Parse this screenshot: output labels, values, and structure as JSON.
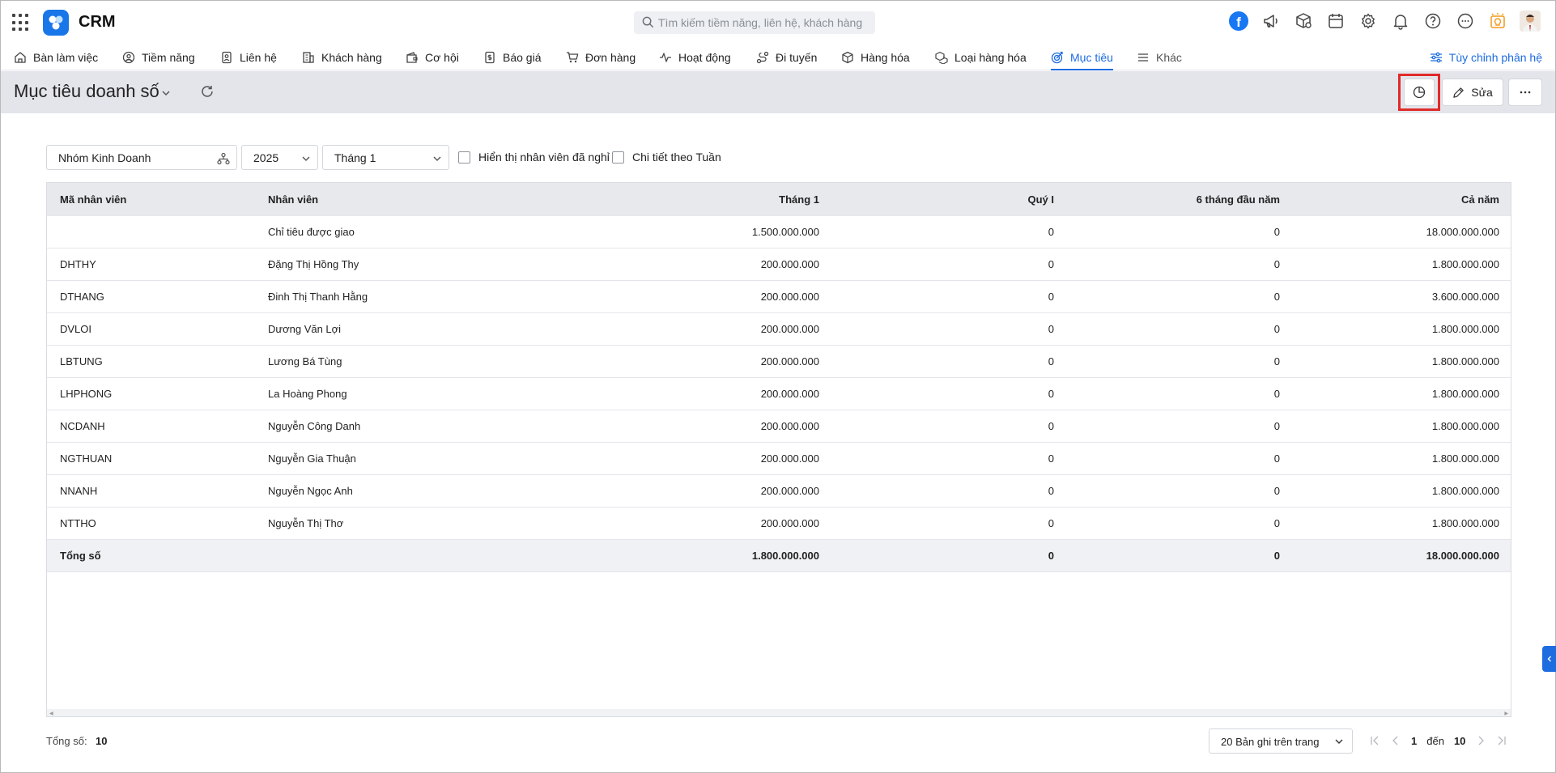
{
  "app": {
    "title": "CRM"
  },
  "search": {
    "placeholder": "Tìm kiếm tiềm năng, liên hệ, khách hàng"
  },
  "top_icons": [
    "facebook-icon",
    "megaphone-icon",
    "package-search-icon",
    "calendar-icon",
    "gear-icon",
    "bell-icon",
    "help-icon",
    "chat-icon",
    "lightbulb-icon",
    "avatar"
  ],
  "nav": {
    "items": [
      {
        "label": "Bàn làm việc",
        "icon": "home-icon"
      },
      {
        "label": "Tiềm năng",
        "icon": "person-circle-icon"
      },
      {
        "label": "Liên hệ",
        "icon": "contact-card-icon"
      },
      {
        "label": "Khách hàng",
        "icon": "building-icon"
      },
      {
        "label": "Cơ hội",
        "icon": "wallet-icon"
      },
      {
        "label": "Báo giá",
        "icon": "quote-icon"
      },
      {
        "label": "Đơn hàng",
        "icon": "cart-icon"
      },
      {
        "label": "Hoạt động",
        "icon": "pulse-icon"
      },
      {
        "label": "Đi tuyến",
        "icon": "route-icon"
      },
      {
        "label": "Hàng hóa",
        "icon": "box-icon"
      },
      {
        "label": "Loại hàng hóa",
        "icon": "boxes-icon"
      },
      {
        "label": "Mục tiêu",
        "icon": "target-icon",
        "active": true
      },
      {
        "label": "Khác",
        "icon": "menu-icon"
      }
    ],
    "customize_label": "Tùy chỉnh phân hệ"
  },
  "page": {
    "title": "Mục tiêu doanh số",
    "edit_label": "Sửa"
  },
  "filters": {
    "group": "Nhóm Kinh Doanh",
    "year": "2025",
    "month": "Tháng 1",
    "show_inactive_label": "Hiển thị nhân viên đã nghỉ",
    "weekly_detail_label": "Chi tiết theo Tuần"
  },
  "table": {
    "headers": {
      "code": "Mã nhân viên",
      "name": "Nhân viên",
      "month": "Tháng 1",
      "quarter": "Quý I",
      "half": "6 tháng đầu năm",
      "year": "Cả năm"
    },
    "rows": [
      {
        "code": "",
        "name": "Chỉ tiêu được giao",
        "month": "1.500.000.000",
        "quarter": "0",
        "half": "0",
        "year": "18.000.000.000"
      },
      {
        "code": "DHTHY",
        "name": "Đặng Thị Hồng Thy",
        "month": "200.000.000",
        "quarter": "0",
        "half": "0",
        "year": "1.800.000.000"
      },
      {
        "code": "DTHANG",
        "name": "Đinh Thị Thanh Hằng",
        "month": "200.000.000",
        "quarter": "0",
        "half": "0",
        "year": "3.600.000.000"
      },
      {
        "code": "DVLOI",
        "name": "Dương Văn Lợi",
        "month": "200.000.000",
        "quarter": "0",
        "half": "0",
        "year": "1.800.000.000"
      },
      {
        "code": "LBTUNG",
        "name": "Lương Bá Tùng",
        "month": "200.000.000",
        "quarter": "0",
        "half": "0",
        "year": "1.800.000.000"
      },
      {
        "code": "LHPHONG",
        "name": "La Hoàng Phong",
        "month": "200.000.000",
        "quarter": "0",
        "half": "0",
        "year": "1.800.000.000"
      },
      {
        "code": "NCDANH",
        "name": "Nguyễn Công Danh",
        "month": "200.000.000",
        "quarter": "0",
        "half": "0",
        "year": "1.800.000.000"
      },
      {
        "code": "NGTHUAN",
        "name": "Nguyễn Gia Thuận",
        "month": "200.000.000",
        "quarter": "0",
        "half": "0",
        "year": "1.800.000.000"
      },
      {
        "code": "NNANH",
        "name": "Nguyễn Ngọc Anh",
        "month": "200.000.000",
        "quarter": "0",
        "half": "0",
        "year": "1.800.000.000"
      },
      {
        "code": "NTTHO",
        "name": "Nguyễn Thị Thơ",
        "month": "200.000.000",
        "quarter": "0",
        "half": "0",
        "year": "1.800.000.000"
      }
    ],
    "total": {
      "label": "Tổng số",
      "month": "1.800.000.000",
      "quarter": "0",
      "half": "0",
      "year": "18.000.000.000"
    }
  },
  "footer": {
    "total_label": "Tổng số:",
    "total_count": "10",
    "page_size": "20 Bản ghi trên trang",
    "from": "1",
    "to_label": "đến",
    "to": "10"
  },
  "colors": {
    "accent": "#1d6ce0",
    "highlight": "#e02a2a",
    "header_bg": "#e3e5ea"
  }
}
